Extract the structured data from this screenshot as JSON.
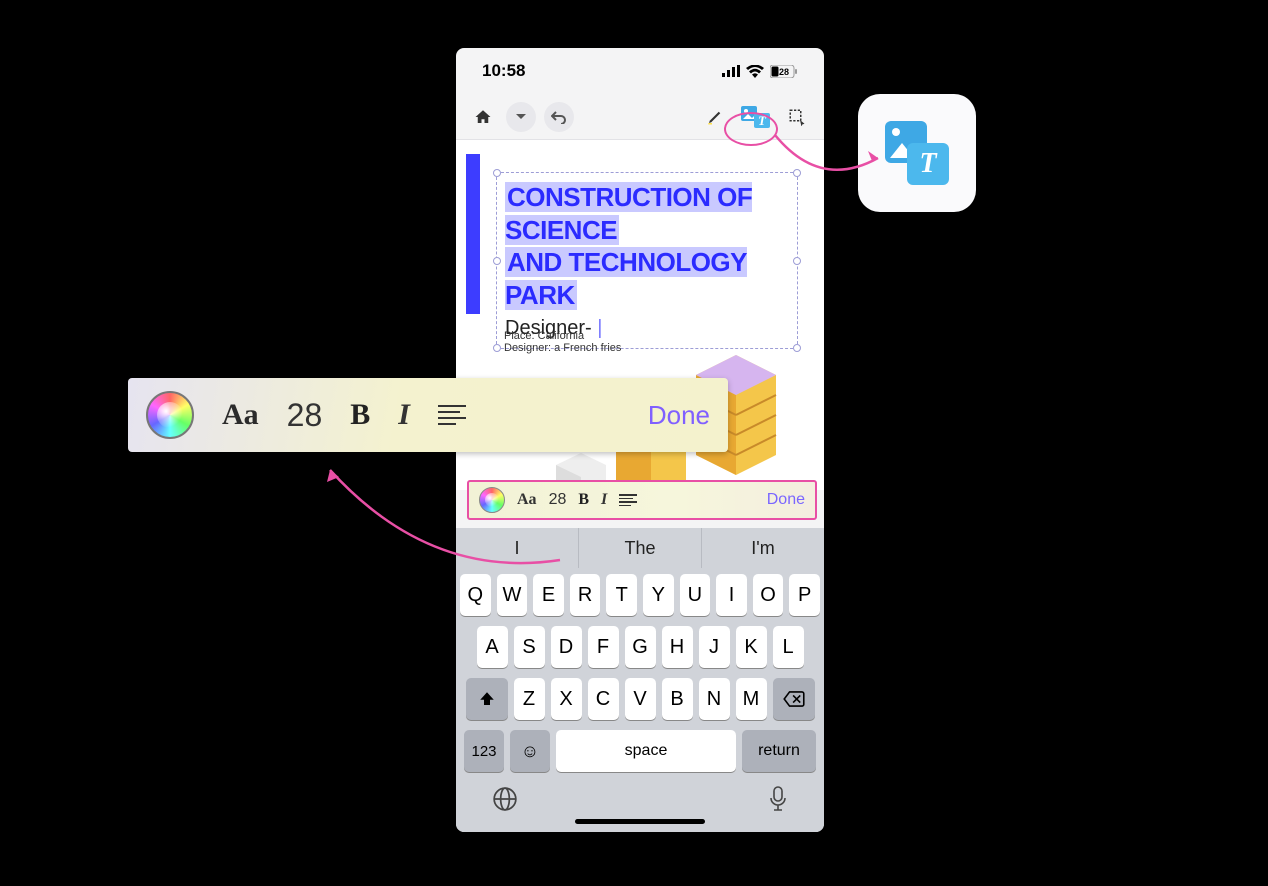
{
  "status": {
    "time": "10:58",
    "battery": "28"
  },
  "toolbar": {
    "text_button": "Image/Text"
  },
  "doc": {
    "title_line1": "CONSTRUCTION OF SCIENCE",
    "title_line2": "AND TECHNOLOGY PARK",
    "designer_label": "Designer- ",
    "meta_place": "Place:  California",
    "meta_designer": "Designer: a French fries"
  },
  "format_bar": {
    "font_button": "Aa",
    "size": "28",
    "bold": "B",
    "italic": "I",
    "done": "Done"
  },
  "suggestions": [
    "I",
    "The",
    "I'm"
  ],
  "keyboard": {
    "row1": [
      "Q",
      "W",
      "E",
      "R",
      "T",
      "Y",
      "U",
      "I",
      "O",
      "P"
    ],
    "row2": [
      "A",
      "S",
      "D",
      "F",
      "G",
      "H",
      "J",
      "K",
      "L"
    ],
    "row3": [
      "Z",
      "X",
      "C",
      "V",
      "B",
      "N",
      "M"
    ],
    "num": "123",
    "space": "space",
    "return": "return"
  }
}
